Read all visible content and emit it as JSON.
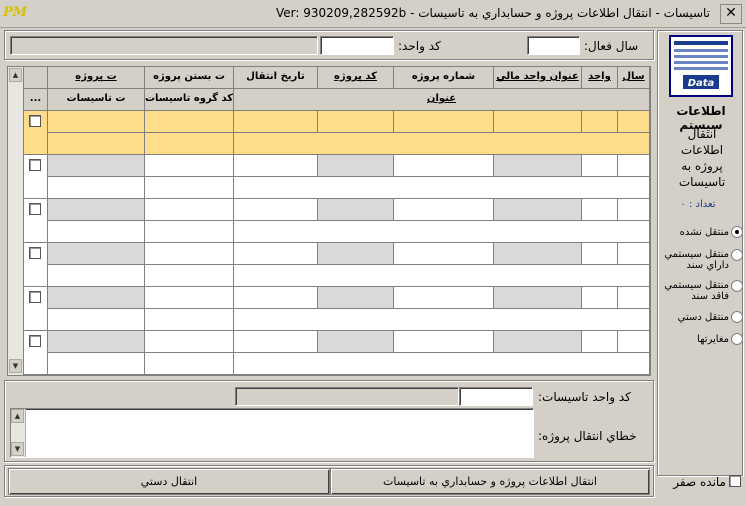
{
  "window": {
    "title": "Ver: 930209,282592b  -  تاسيسات - انتقال اطلاعات پروژه و حسابداري به تاسيسات",
    "app_icon_text": "PM",
    "close_symbol": "✕"
  },
  "filters": {
    "fiscal_year_label": "سال فعال:",
    "fiscal_year_value": "",
    "unit_code_label": "کد واحد:",
    "unit_code_value": "",
    "unit_name_value": ""
  },
  "grid": {
    "header_row1": [
      "سال",
      "واحد",
      "عنوان واحد مالي",
      "شماره پروژه",
      "کد پروژه",
      "تاريخ انتقال",
      "ت بستن پروژه",
      "ت پروژه"
    ],
    "header_row2": {
      "title": "عنوان",
      "group_code": "کد گروه تاسيسات",
      "facility_date": "ت  تاسيسات"
    },
    "more_button": "..."
  },
  "sidebar": {
    "icon_caption": "Data",
    "heading": "اطلاعات سيستم",
    "subtitle": "انتقال اطلاعات پروژه به تاسيسات",
    "count_label": "تعداد : ۰",
    "filter_options": [
      {
        "label": "منتقل نشده",
        "checked": true
      },
      {
        "label": "منتقل سيستمي داراي سند",
        "checked": false
      },
      {
        "label": "منتقل سيستمي فاقد سند",
        "checked": false
      },
      {
        "label": "منتقل دستي",
        "checked": false
      },
      {
        "label": "مغايرتها",
        "checked": false
      }
    ]
  },
  "details": {
    "facility_unit_label": "کد واحد تاسيسات:",
    "facility_unit_code": "",
    "facility_unit_name": "",
    "error_label": "خطاي انتقال پروژه:",
    "error_text": ""
  },
  "actions": {
    "transfer_button": "انتقال اطلاعات پروژه و حسابداري به تاسيسات",
    "manual_button": "انتقال دستي",
    "zero_balance_label": "مانده صفر"
  }
}
